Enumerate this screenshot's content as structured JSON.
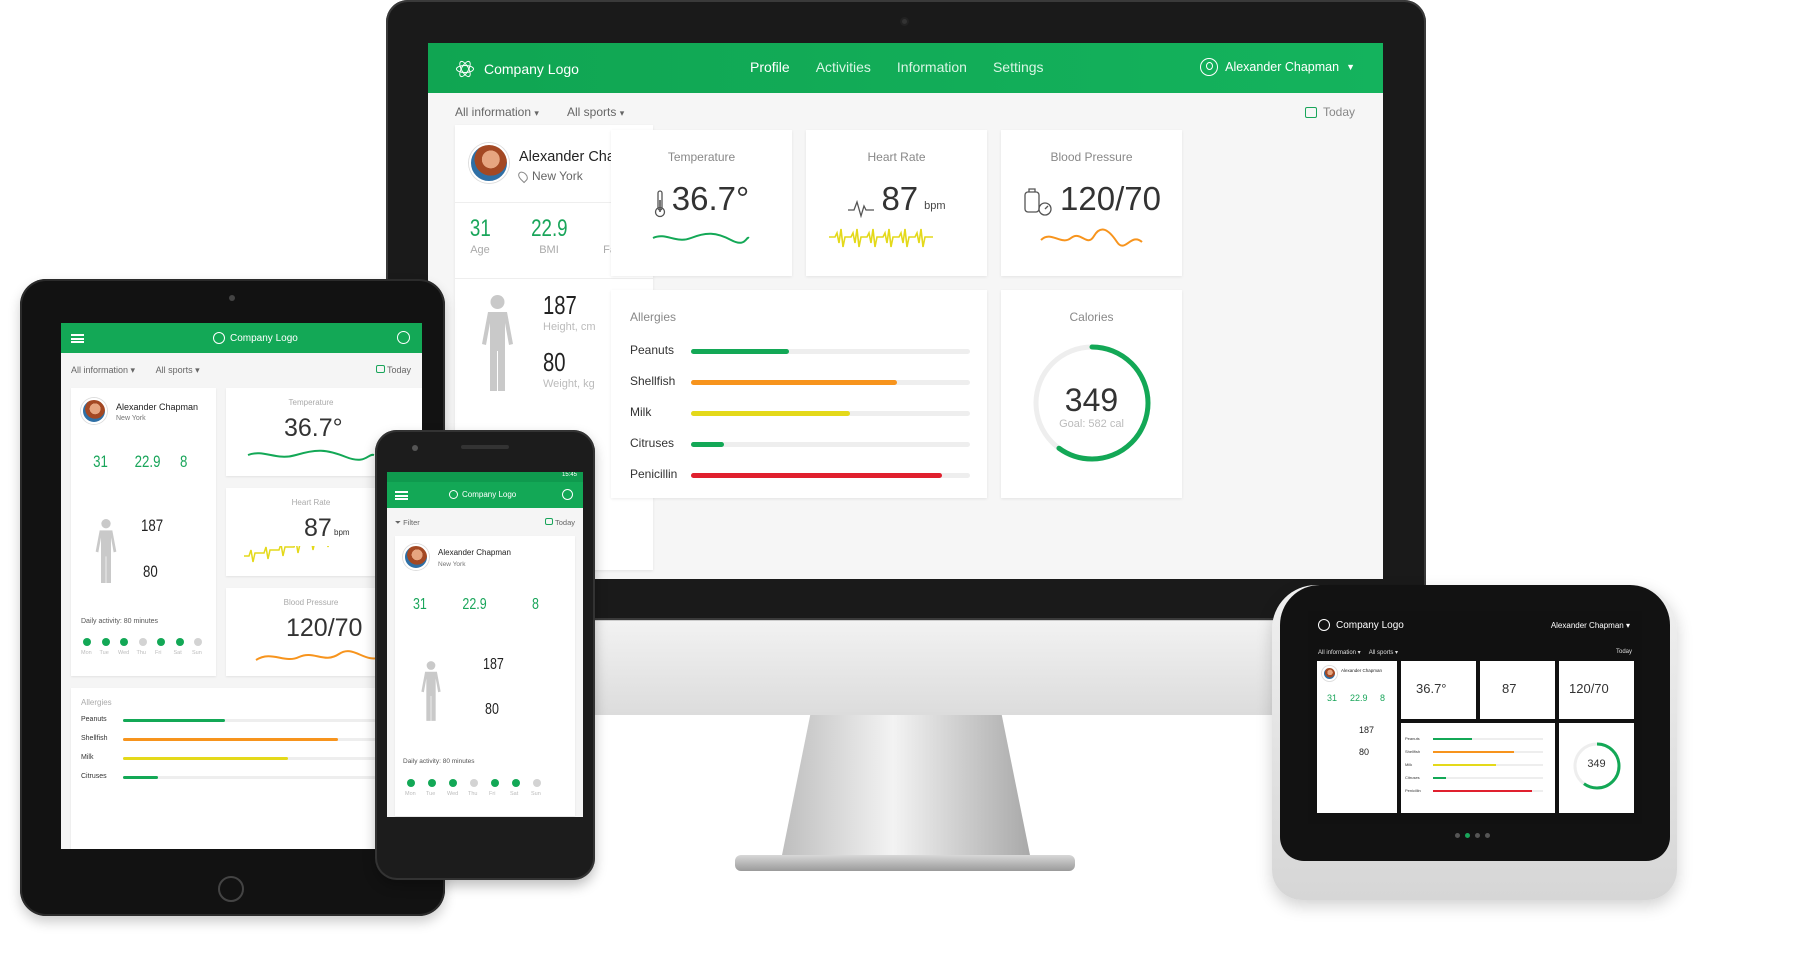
{
  "app": {
    "logo_text": "Company Logo",
    "nav": [
      "Profile",
      "Activities",
      "Information",
      "Settings"
    ],
    "active_nav": "Profile",
    "user_name": "Alexander Chapman"
  },
  "filters": {
    "info": "All information",
    "sports": "All sports",
    "date": "Today",
    "filter": "Filter"
  },
  "profile": {
    "name": "Alexander Chapman",
    "location": "New York",
    "age": {
      "value": "31",
      "label": "Age"
    },
    "bmi": {
      "value": "22.9",
      "label": "BMI"
    },
    "fat": {
      "value": "8",
      "label": "Fat, %"
    },
    "height": {
      "value": "187",
      "label": "Height, cm"
    },
    "weight": {
      "value": "80",
      "label": "Weight, kg"
    },
    "daily_activity": "Daily activity: 80 minutes",
    "days": [
      "Mon",
      "Tue",
      "Wed",
      "Thu",
      "Fri",
      "Sat",
      "Sun"
    ],
    "days_active": [
      true,
      true,
      true,
      false,
      true,
      true,
      false
    ]
  },
  "metrics": {
    "temperature": {
      "title": "Temperature",
      "value": "36.7°"
    },
    "heart_rate": {
      "title": "Heart Rate",
      "value": "87",
      "unit": "bpm"
    },
    "blood_pressure": {
      "title": "Blood Pressure",
      "value": "120/70"
    }
  },
  "allergies": {
    "title": "Allergies",
    "items": [
      {
        "label": "Peanuts",
        "level": 0.35,
        "color": "#13a856"
      },
      {
        "label": "Shellfish",
        "level": 0.74,
        "color": "#f7941d"
      },
      {
        "label": "Milk",
        "level": 0.57,
        "color": "#e4d91a"
      },
      {
        "label": "Citruses",
        "level": 0.12,
        "color": "#13a856"
      },
      {
        "label": "Penicillin",
        "level": 0.9,
        "color": "#e0202e"
      }
    ]
  },
  "calories": {
    "title": "Calories",
    "value": "349",
    "goal": "Goal: 582 cal",
    "progress": 0.6
  },
  "phone_status": {
    "time": "15:45"
  },
  "colors": {
    "brand": "#13a856",
    "accent": "#19a55a"
  }
}
